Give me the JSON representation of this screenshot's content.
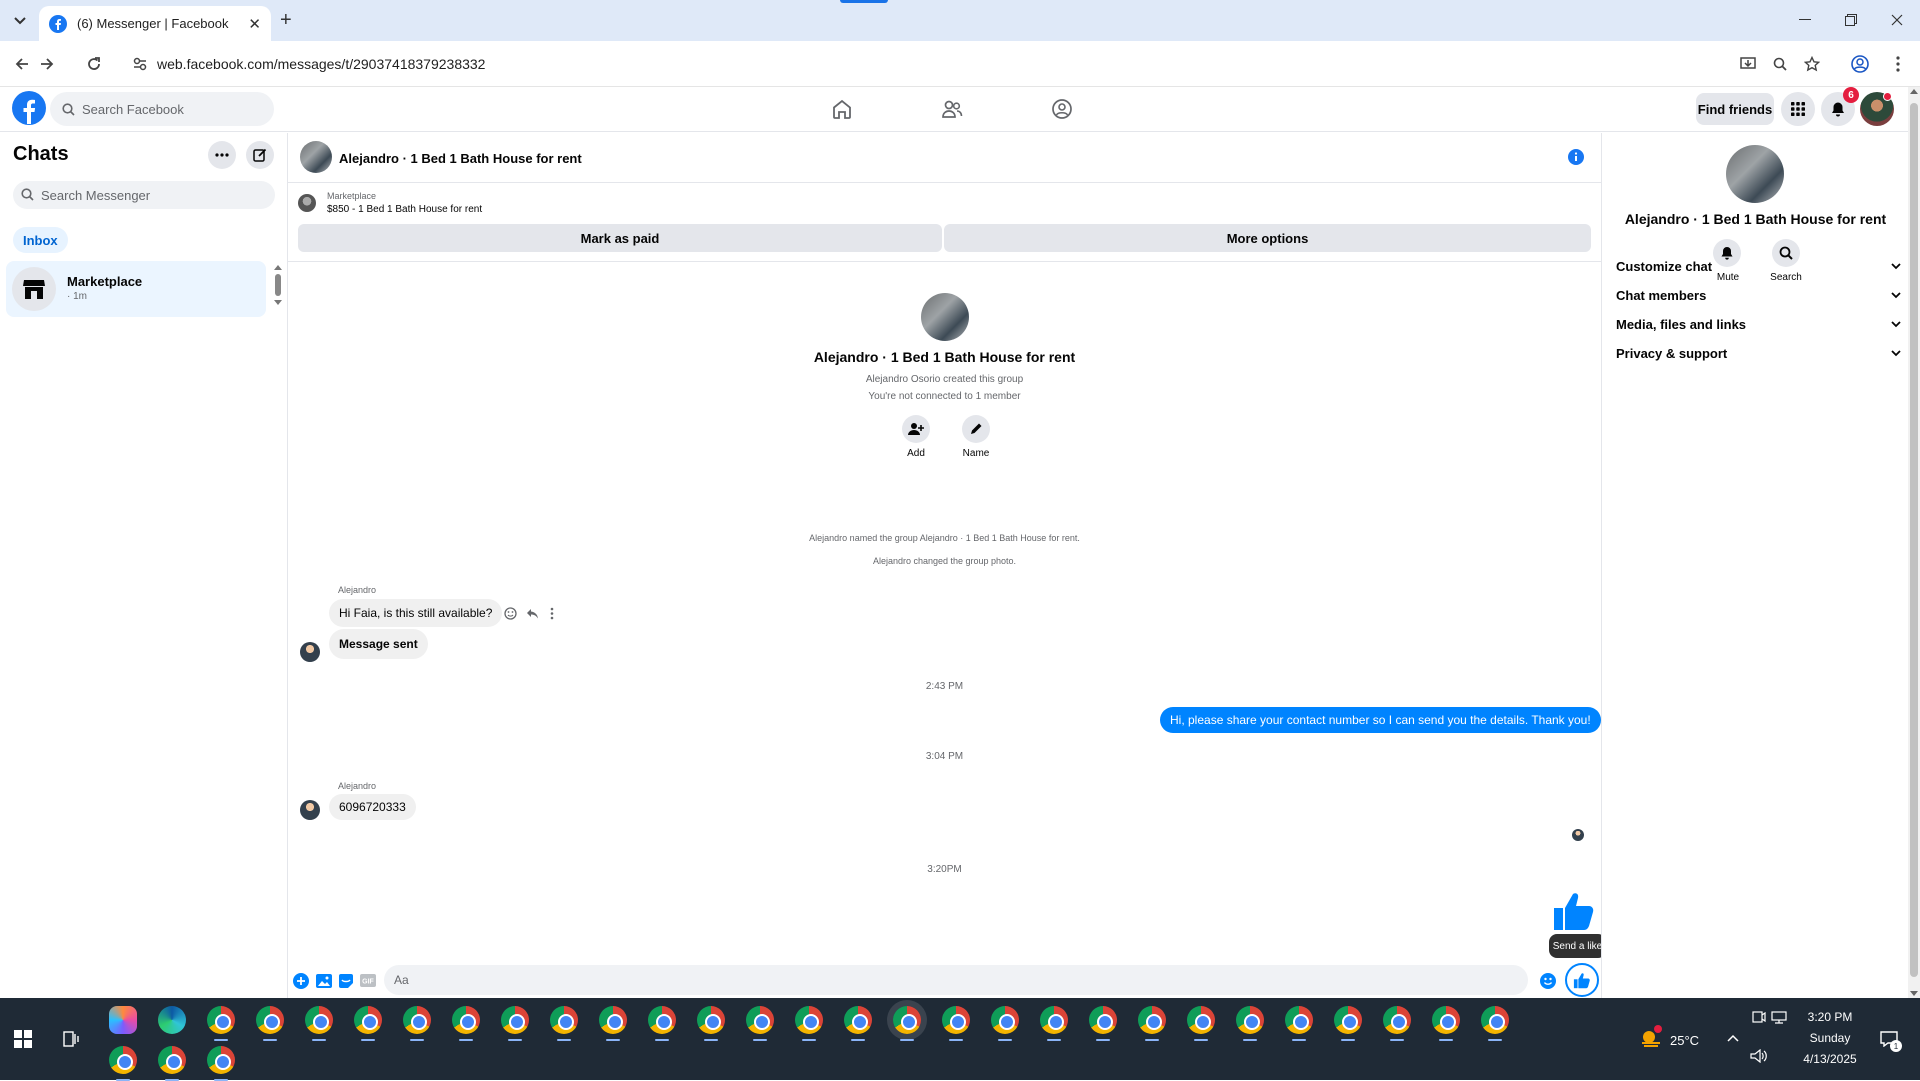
{
  "browser": {
    "tab_title": "(6) Messenger | Facebook",
    "url": "web.facebook.com/messages/t/29037418379238332"
  },
  "fb_header": {
    "search_placeholder": "Search Facebook",
    "find_friends": "Find friends",
    "notification_count": "6"
  },
  "sidebar": {
    "title": "Chats",
    "search_placeholder": "Search Messenger",
    "filter_inbox": "Inbox",
    "chats": [
      {
        "name": "Marketplace",
        "meta": "· 1m"
      }
    ]
  },
  "conversation": {
    "title": "Alejandro · 1 Bed 1 Bath House for rent",
    "marketplace_label": "Marketplace",
    "listing": "$850 - 1 Bed 1 Bath House for rent",
    "mark_paid": "Mark as paid",
    "more_options": "More options",
    "group_name": "Alejandro · 1 Bed 1 Bath House for rent",
    "created_by": "Alejandro Osorio created this group",
    "connection_note": "You're not connected to 1 member",
    "add_label": "Add",
    "name_label": "Name",
    "event_named": "Alejandro named the group Alejandro · 1 Bed 1 Bath House for rent.",
    "event_photo": "Alejandro changed the group photo.",
    "sender_1": "Alejandro",
    "msg_1": "Hi Faia, is this still available?",
    "msg_2": "Message sent",
    "time_1": "2:43 PM",
    "my_msg": "Hi, please share your contact number so I can send you the details. Thank you!",
    "time_2": "3:04 PM",
    "sender_2": "Alejandro",
    "msg_3": "6096720333",
    "time_3": "3:20PM",
    "composer_placeholder": "Aa",
    "tooltip": "Send a like"
  },
  "details": {
    "title": "Alejandro · 1 Bed 1 Bath House for rent",
    "mute": "Mute",
    "search": "Search",
    "sections": [
      "Customize chat",
      "Chat members",
      "Media, files and links",
      "Privacy & support"
    ]
  },
  "taskbar": {
    "weather": "25°C",
    "time": "3:20 PM",
    "day": "Sunday",
    "date": "4/13/2025",
    "notif_count": "1"
  },
  "colors": {
    "accent": "#0084ff",
    "fb_blue": "#1877f2",
    "taskbar": "#1f2a36"
  }
}
